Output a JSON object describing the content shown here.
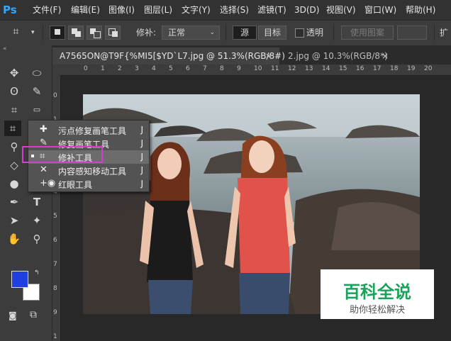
{
  "app": {
    "logo": "Ps"
  },
  "menu": [
    "文件(F)",
    "编辑(E)",
    "图像(I)",
    "图层(L)",
    "文字(Y)",
    "选择(S)",
    "滤镜(T)",
    "3D(D)",
    "视图(V)",
    "窗口(W)",
    "帮助(H)"
  ],
  "options": {
    "patch_label": "修补:",
    "patch_value": "正常",
    "source": "源",
    "target": "目标",
    "transparent": "透明",
    "use_pattern": "使用图案",
    "diffuse": "扩"
  },
  "tabs": [
    {
      "title": "A7565ON@T9F{%MI5[$YD`L7.jpg @ 51.3%(RGB/8#)",
      "close": "×"
    },
    {
      "title": "2.jpg @ 10.3%(RGB/8*)",
      "close": "×"
    }
  ],
  "ruler": {
    "h_labels": [
      "0",
      "1",
      "2",
      "3",
      "4",
      "5",
      "6",
      "7",
      "8",
      "9",
      "10",
      "11",
      "12",
      "13",
      "14",
      "15",
      "16",
      "17",
      "18",
      "19",
      "20"
    ],
    "v_labels": [
      "0",
      "1",
      "2",
      "3",
      "4",
      "5",
      "6",
      "7",
      "8",
      "9",
      "1"
    ]
  },
  "flyout": [
    {
      "label": "污点修复画笔工具",
      "key": "J",
      "icon": "spot-healing-brush-icon",
      "selected": false
    },
    {
      "label": "修复画笔工具",
      "key": "J",
      "icon": "healing-brush-icon",
      "selected": false
    },
    {
      "label": "修补工具",
      "key": "J",
      "icon": "patch-icon",
      "selected": true
    },
    {
      "label": "内容感知移动工具",
      "key": "J",
      "icon": "content-aware-move-icon",
      "selected": false
    },
    {
      "label": "红眼工具",
      "key": "J",
      "icon": "red-eye-icon",
      "selected": false
    }
  ],
  "watermark": {
    "main": "百科全说",
    "sub": "助你轻松解决"
  },
  "colors": {
    "foreground": "#1f3fe0",
    "background": "#ffffff",
    "highlight": "#d13ed1",
    "ps_blue": "#31a8ff"
  }
}
